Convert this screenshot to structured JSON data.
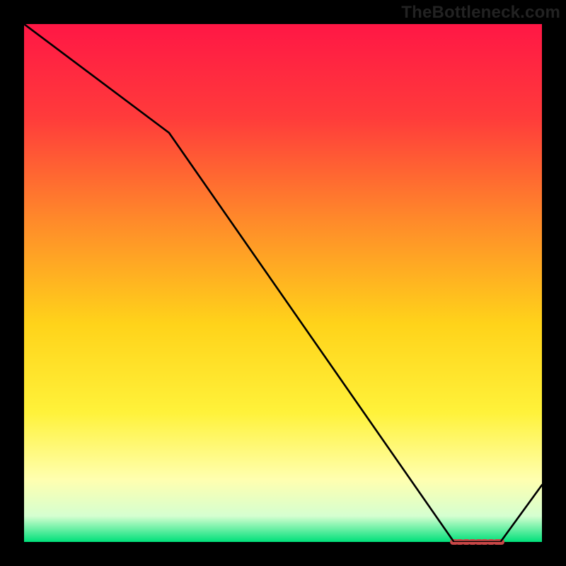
{
  "attribution": "TheBottleneck.com",
  "chart_data": {
    "type": "line",
    "title": "",
    "xlabel": "",
    "ylabel": "",
    "xlim": [
      0,
      100
    ],
    "ylim": [
      0,
      100
    ],
    "x": [
      0,
      28,
      83,
      92,
      100
    ],
    "values": [
      100,
      79,
      0,
      0,
      11
    ],
    "marker_x": [
      83,
      84.2,
      85.4,
      86.6,
      87.8,
      89,
      90.2,
      91.4,
      92
    ],
    "background": {
      "type": "vertical-gradient",
      "stops": [
        {
          "pct": 0,
          "color": "#ff1745"
        },
        {
          "pct": 18,
          "color": "#ff3b3b"
        },
        {
          "pct": 38,
          "color": "#ff8a2a"
        },
        {
          "pct": 58,
          "color": "#ffd31a"
        },
        {
          "pct": 75,
          "color": "#fff23a"
        },
        {
          "pct": 88,
          "color": "#ffffb0"
        },
        {
          "pct": 95,
          "color": "#d5ffd0"
        },
        {
          "pct": 100,
          "color": "#00e07a"
        }
      ]
    }
  }
}
